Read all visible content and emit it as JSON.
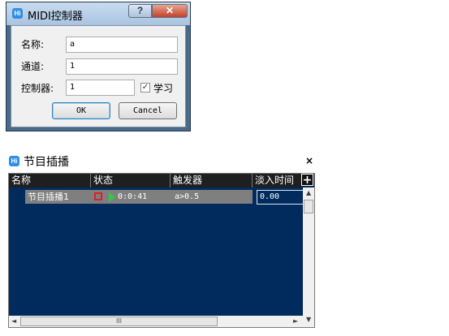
{
  "midi_dialog": {
    "app_badge": "Hi",
    "title": "MIDI控制器",
    "help_glyph": "?",
    "close_glyph": "✕",
    "name_label": "名称:",
    "name_value": "a",
    "channel_label": "通道:",
    "channel_value": "1",
    "controller_label": "控制器:",
    "controller_value": "1",
    "learn_checked": "✓",
    "learn_label": "学习",
    "ok_label": "OK",
    "cancel_label": "Cancel"
  },
  "program_panel": {
    "app_badge": "Hi",
    "title": "节目插播",
    "close_glyph": "×",
    "add_glyph": "+",
    "columns": [
      "名称",
      "状态",
      "触发器",
      "淡入时间"
    ],
    "rows": [
      {
        "name": "节目插播1",
        "time": "0:0:41",
        "trigger": "a>0.5",
        "fade_in": "0.00"
      }
    ],
    "scroll": {
      "up": "▲",
      "down": "▼",
      "left": "◄",
      "right": "►",
      "grip": "III"
    }
  },
  "colors": {
    "grid_background": "#002b5c",
    "row_highlight": "#7f7f7f",
    "stop_icon": "#e02020",
    "play_icon": "#2ecc40"
  }
}
